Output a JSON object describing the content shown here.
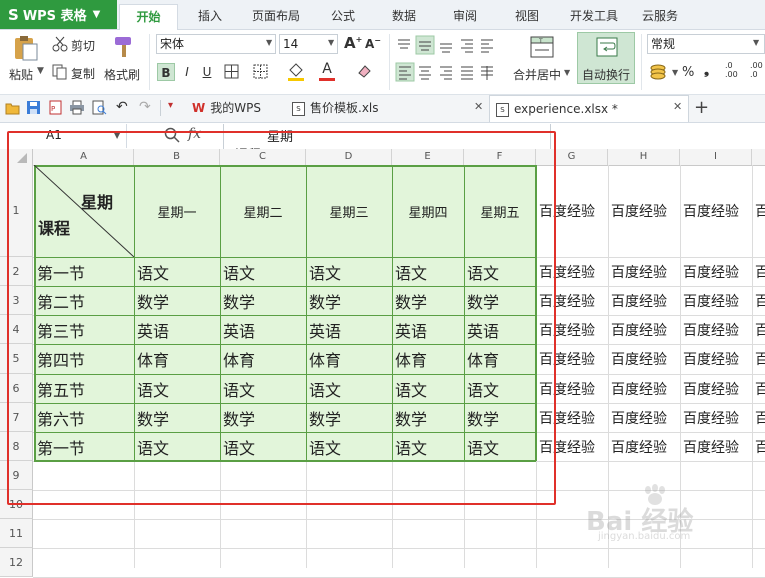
{
  "app": {
    "name": "WPS 表格"
  },
  "ribbon_tabs": [
    "开始",
    "插入",
    "页面布局",
    "公式",
    "数据",
    "审阅",
    "视图",
    "开发工具",
    "云服务"
  ],
  "clipboard": {
    "paste": "粘贴",
    "cut": "剪切",
    "copy": "复制",
    "format_painter": "格式刷"
  },
  "font": {
    "name": "宋体",
    "size": "14",
    "bold": "B",
    "italic": "I",
    "underline": "U",
    "font_color_glyph": "A"
  },
  "alignment": {
    "merge_center": "合并居中",
    "wrap_text": "自动换行"
  },
  "number": {
    "format": "常规",
    "percent": "%",
    "comma": "❟",
    "inc_decimal": ".00",
    "dec_decimal": ".0"
  },
  "doc_tabs": [
    {
      "label": "我的WPS"
    },
    {
      "label": "售价模板.xls"
    },
    {
      "label": "experience.xlsx *"
    }
  ],
  "formula_bar": {
    "cell_ref": "A1",
    "fx": "fx",
    "content_line1": "星期",
    "content_line2": "课程"
  },
  "columns": [
    "A",
    "B",
    "C",
    "D",
    "E",
    "F",
    "G",
    "H",
    "I"
  ],
  "rows": [
    "1",
    "2",
    "3",
    "4",
    "5",
    "6",
    "7",
    "8",
    "9",
    "10",
    "11",
    "12"
  ],
  "table": {
    "corner_top": "星期",
    "corner_bottom": "课程",
    "headers": [
      "星期一",
      "星期二",
      "星期三",
      "星期四",
      "星期五"
    ],
    "body": [
      [
        "第一节",
        "语文",
        "语文",
        "语文",
        "语文",
        "语文"
      ],
      [
        "第二节",
        "数学",
        "数学",
        "数学",
        "数学",
        "数学"
      ],
      [
        "第三节",
        "英语",
        "英语",
        "英语",
        "英语",
        "英语"
      ],
      [
        "第四节",
        "体育",
        "体育",
        "体育",
        "体育",
        "体育"
      ],
      [
        "第五节",
        "语文",
        "语文",
        "语文",
        "语文",
        "语文"
      ],
      [
        "第六节",
        "数学",
        "数学",
        "数学",
        "数学",
        "数学"
      ],
      [
        "第一节",
        "语文",
        "语文",
        "语文",
        "语文",
        "语文"
      ]
    ]
  },
  "overflow_text": "百度经验",
  "watermark": {
    "text": "Bai 经验",
    "url": "jingyan.baidu.com"
  },
  "colors": {
    "brand_green": "#2f9a3f",
    "table_fill": "#e2f5da",
    "table_border": "#5a9f44",
    "annotation_red": "#e0302a"
  }
}
